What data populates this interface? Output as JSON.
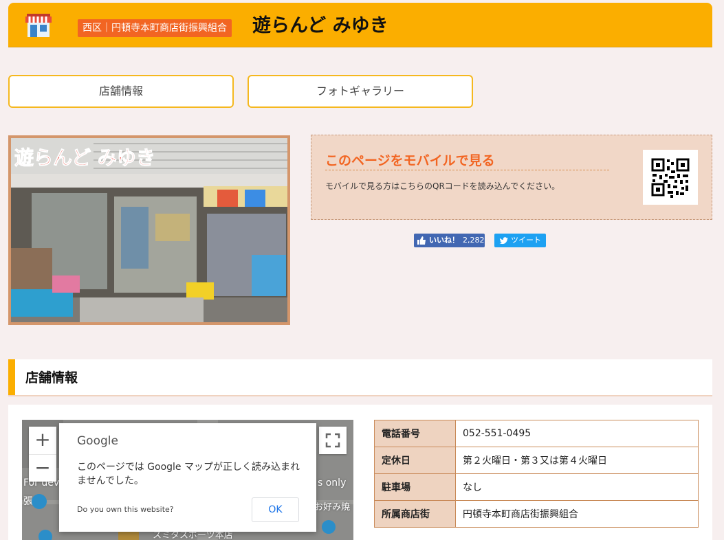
{
  "header": {
    "district_badge": "西区｜円頓寺本町商店街振興組合",
    "shop_name": "遊らんど みゆき",
    "logo_icon": "storefront-icon"
  },
  "tabs": [
    {
      "label": "店舗情報"
    },
    {
      "label": "フォトギャラリー"
    }
  ],
  "photo": {
    "sign_text": "遊らんど みゆき"
  },
  "mobile": {
    "title": "このページをモバイルで見る",
    "text": "モバイルで見る方はこちらのQRコードを読み込んでください。",
    "qr_icon": "qr-code-icon"
  },
  "social": {
    "like_label": "いいね！",
    "like_count": "2,282",
    "tweet_label": "ツイート"
  },
  "section": {
    "title": "店舗情報"
  },
  "map": {
    "dialog_logo": "Google",
    "dialog_message": "このページでは Google マップが正しく読み込まれませんでした。",
    "dialog_own": "Do you own this website?",
    "dialog_ok": "OK",
    "label_left": "For dev",
    "label_left2": "張",
    "label_right": "s only",
    "label_right2": "お好み焼",
    "label_bottom": "スミタスポーツ本店",
    "zoom_in": "+",
    "zoom_out": "−"
  },
  "info": {
    "rows": [
      {
        "label": "電話番号",
        "value": "052-551-0495"
      },
      {
        "label": "定休日",
        "value": "第２火曜日・第３又は第４火曜日"
      },
      {
        "label": "駐車場",
        "value": "なし"
      },
      {
        "label": "所属商店街",
        "value": "円頓寺本町商店街振興組合"
      }
    ]
  },
  "colors": {
    "header": "#fbae00",
    "badge": "#f26522",
    "accent": "#f26522",
    "facebook": "#4267b2",
    "twitter": "#1da1f2"
  }
}
